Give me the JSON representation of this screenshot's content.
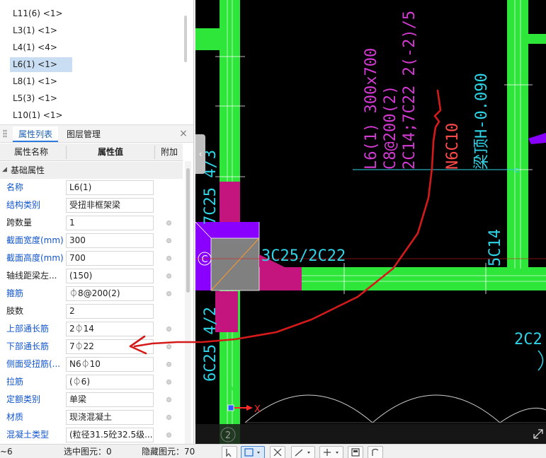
{
  "tree": {
    "items": [
      {
        "label": "L11(6) <1>",
        "selected": false
      },
      {
        "label": "L3(1) <1>",
        "selected": false
      },
      {
        "label": "L4(1) <4>",
        "selected": false
      },
      {
        "label": "L6(1) <1>",
        "selected": true
      },
      {
        "label": "L8(1) <1>",
        "selected": false
      },
      {
        "label": "L5(3) <1>",
        "selected": false
      },
      {
        "label": "L10(1) <1>",
        "selected": false
      }
    ]
  },
  "tabs": {
    "properties": "属性列表",
    "layers": "图层管理",
    "close": "×"
  },
  "grid": {
    "header": {
      "name": "属性名称",
      "value": "属性值",
      "extra": "附加"
    },
    "group": "基础属性",
    "rows": [
      {
        "name": "名称",
        "value": "L6(1)",
        "blue": true,
        "check": false
      },
      {
        "name": "结构类别",
        "value": "受扭非框架梁",
        "blue": true,
        "check": false
      },
      {
        "name": "跨数量",
        "value": "1",
        "blue": false,
        "check": true
      },
      {
        "name": "截面宽度(mm)",
        "value": "300",
        "blue": true,
        "check": true
      },
      {
        "name": "截面高度(mm)",
        "value": "700",
        "blue": true,
        "check": true
      },
      {
        "name": "轴线距梁左...",
        "value": "(150)",
        "blue": false,
        "check": true
      },
      {
        "name": "箍筋",
        "value": "⏀8@200(2)",
        "blue": true,
        "check": true
      },
      {
        "name": "肢数",
        "value": "2",
        "blue": false,
        "check": false
      },
      {
        "name": "上部通长筋",
        "value": "2⏀14",
        "blue": true,
        "check": true
      },
      {
        "name": "下部通长筋",
        "value": "7⏀22",
        "blue": true,
        "check": true
      },
      {
        "name": "侧面受扭筋(...",
        "value": "N6⏀10",
        "blue": true,
        "check": true
      },
      {
        "name": "拉筋",
        "value": "(⏀6)",
        "blue": true,
        "check": true
      },
      {
        "name": "定额类别",
        "value": "单梁",
        "blue": true,
        "check": true
      },
      {
        "name": "材质",
        "value": "现浇混凝土",
        "blue": true,
        "check": true
      },
      {
        "name": "混凝土类型",
        "value": "(粒径31.5砼32.5级...",
        "blue": true,
        "check": true
      }
    ]
  },
  "cad": {
    "beam_annotation": [
      "L6(1) 300x700",
      "C8@200(2)",
      "2C14;7C22 2(-2)/5",
      "N6C10",
      "梁顶H-0.090"
    ],
    "rebar_labels": {
      "left_vertical": "7C25 4/3",
      "horizontal": "3C25/2C22",
      "right_vertical": "5C14",
      "right_partial": "2C2",
      "bottom_left": "6C25 4/2"
    },
    "column_marker": "C",
    "axis_marker": "2",
    "axis_x_label": "X",
    "expand_icon": "expand-icon"
  },
  "status": {
    "floor": "~6",
    "selected_label": "选中图元：0",
    "hidden_label": "隐藏图元：70"
  },
  "colors": {
    "beam_green": "#2ee53a",
    "column_magenta": "#c4157e",
    "column_purple": "#8a00ff",
    "column_grey": "#808080",
    "annotation_magenta": "#d23ad2",
    "annotation_cyan": "#2fd3e6",
    "red_arrow": "#d41a1a",
    "selected_row": "#c9ddf3"
  }
}
